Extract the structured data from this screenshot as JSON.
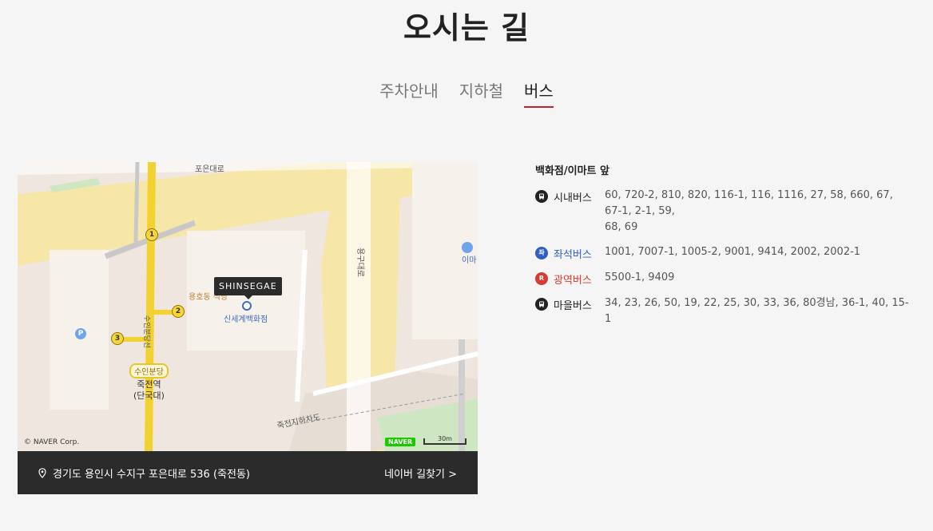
{
  "page_title": "오시는 길",
  "tabs": [
    {
      "label": "주차안내",
      "active": false
    },
    {
      "label": "지하철",
      "active": false
    },
    {
      "label": "버스",
      "active": true
    }
  ],
  "map": {
    "marker_label": "SHINSEGAE",
    "store_label": "신세계백화점",
    "yonghodong_label": "용호동 식당",
    "station_badge": "수인분당",
    "station_name_line1": "죽전역",
    "station_name_line2": "(단국대)",
    "exits": [
      "1",
      "2",
      "3"
    ],
    "parking_label": "P",
    "emart_label": "이마",
    "underpass_label": "죽전지하차도",
    "road_label_top": "포은대로",
    "road_label_vertical": "용구대로",
    "road_label_left": "수인분당선",
    "copyright": "© NAVER Corp.",
    "naver_logo": "NAVER",
    "scale": "30m",
    "accent_marker_color": "#2b2b2b",
    "line_color": "#f2d230"
  },
  "address_bar": {
    "address": "경기도 용인시 수지구 포은대로 536 (죽전동)",
    "route_link": "네이버 길찾기 >",
    "pin_icon": "map-pin-icon"
  },
  "bus_info": {
    "heading": "백화점/이마트 앞",
    "rows": [
      {
        "type": "시내버스",
        "numbers_line1": "60, 720-2, 810, 820, 116-1, 116, 1116, 27, 58, 660, 67, 67-1, 2-1, 59,",
        "numbers_line2": "68, 69",
        "icon_text": "",
        "icon_color": "#222222",
        "label_color": "#222222"
      },
      {
        "type": "좌석버스",
        "numbers_line1": "1001, 7007-1, 1005-2, 9001, 9414, 2002, 2002-1",
        "numbers_line2": "",
        "icon_text": "좌",
        "icon_color": "#2e5fc2",
        "label_color": "#2e5fc2"
      },
      {
        "type": "광역버스",
        "numbers_line1": "5500-1, 9409",
        "numbers_line2": "",
        "icon_text": "R",
        "icon_color": "#d83b2f",
        "label_color": "#d83b2f"
      },
      {
        "type": "마을버스",
        "numbers_line1": "34, 23, 26, 50, 19, 22, 25, 30, 33, 36, 80경남, 36-1, 40, 15-1",
        "numbers_line2": "",
        "icon_text": "",
        "icon_color": "#222222",
        "label_color": "#222222"
      }
    ]
  }
}
